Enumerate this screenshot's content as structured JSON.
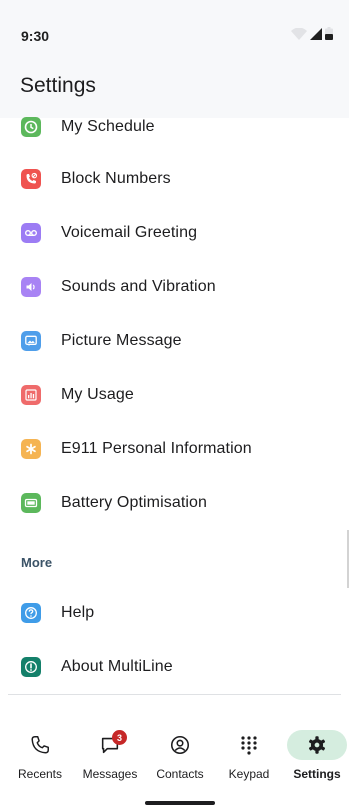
{
  "status": {
    "time": "9:30"
  },
  "header": {
    "title": "Settings"
  },
  "settings": [
    {
      "label": "My Schedule",
      "icon": "schedule-icon",
      "color": "#5cb85c"
    },
    {
      "label": "Block Numbers",
      "icon": "block-numbers-icon",
      "color": "#ef5350"
    },
    {
      "label": "Voicemail Greeting",
      "icon": "voicemail-icon",
      "color": "#9c7cf4"
    },
    {
      "label": "Sounds and Vibration",
      "icon": "sound-icon",
      "color": "#a883f4"
    },
    {
      "label": "Picture Message",
      "icon": "picture-icon",
      "color": "#4f9eea"
    },
    {
      "label": "My Usage",
      "icon": "usage-icon",
      "color": "#ef6b6b"
    },
    {
      "label": "E911 Personal Information",
      "icon": "e911-icon",
      "color": "#f5b453"
    },
    {
      "label": "Battery Optimisation",
      "icon": "battery-icon",
      "color": "#5cb85c"
    }
  ],
  "more": {
    "title": "More",
    "items": [
      {
        "label": "Help",
        "icon": "help-icon",
        "color": "#3f9ce8"
      },
      {
        "label": "About MultiLine",
        "icon": "about-icon",
        "color": "#14806a"
      }
    ]
  },
  "nav": {
    "tabs": [
      {
        "label": "Recents",
        "icon": "phone-icon"
      },
      {
        "label": "Messages",
        "icon": "chat-icon",
        "badge": "3"
      },
      {
        "label": "Contacts",
        "icon": "contacts-icon"
      },
      {
        "label": "Keypad",
        "icon": "keypad-icon"
      },
      {
        "label": "Settings",
        "icon": "settings-gear-icon",
        "active": true
      }
    ]
  }
}
